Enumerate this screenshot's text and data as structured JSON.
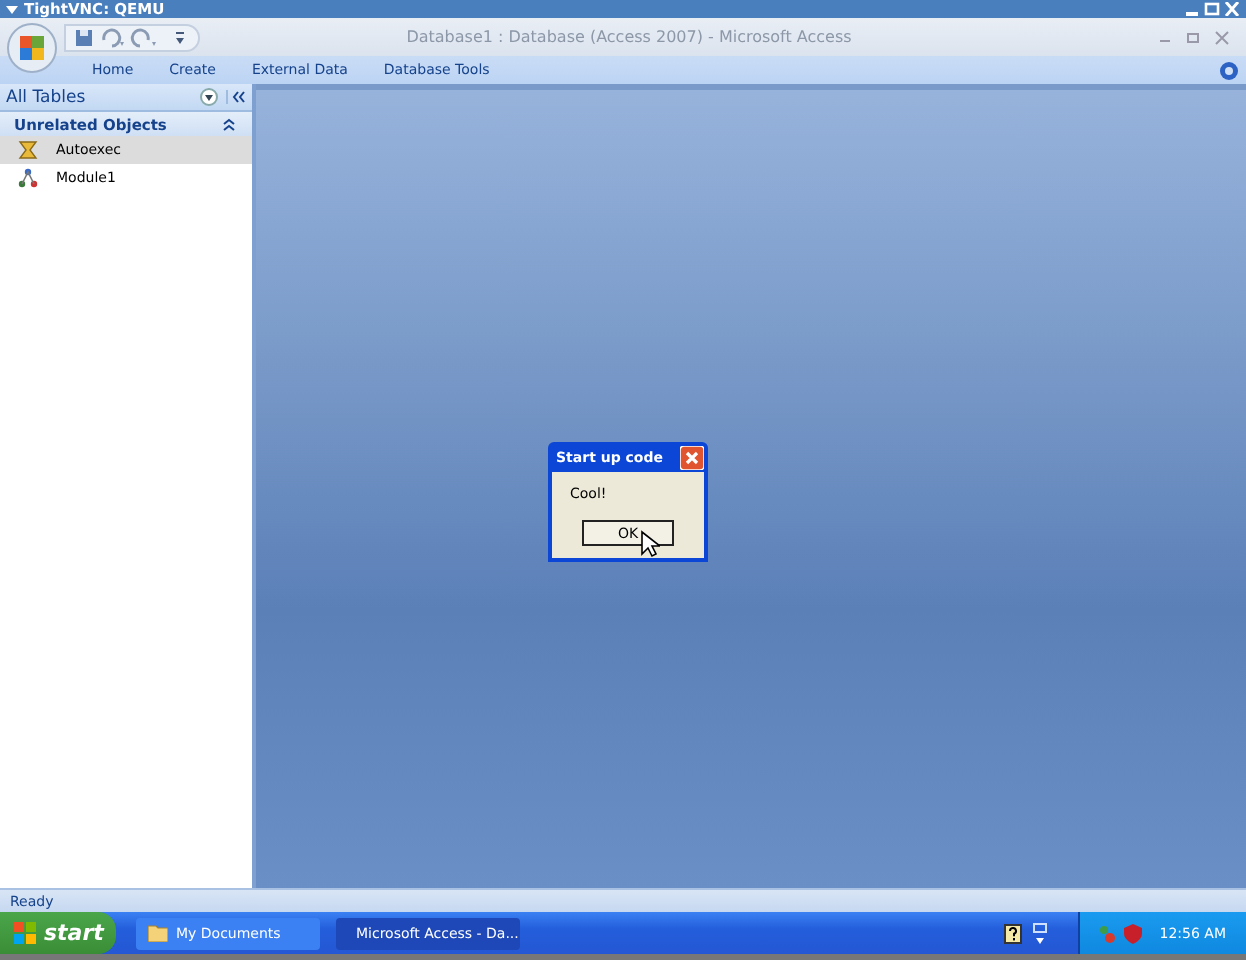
{
  "vnc_window": {
    "title": "TightVNC: QEMU"
  },
  "access_window": {
    "title": "Database1 : Database (Access 2007) - Microsoft Access"
  },
  "ribbon_tabs": [
    {
      "label": "Home"
    },
    {
      "label": "Create"
    },
    {
      "label": "External Data"
    },
    {
      "label": "Database Tools"
    }
  ],
  "navigation_pane": {
    "header": "All Tables",
    "group": "Unrelated Objects",
    "items": [
      {
        "label": "Autoexec",
        "kind": "macro",
        "selected": true
      },
      {
        "label": "Module1",
        "kind": "module",
        "selected": false
      }
    ]
  },
  "dialog": {
    "title": "Start up code",
    "message": "Cool!",
    "button": "OK"
  },
  "status_bar": {
    "text": "Ready"
  },
  "taskbar": {
    "start": "start",
    "tasks": [
      {
        "label": "My Documents",
        "kind": "folder",
        "selected": false
      },
      {
        "label": "Microsoft Access - Da...",
        "kind": "access",
        "selected": true
      }
    ],
    "clock": "12:56 AM"
  }
}
